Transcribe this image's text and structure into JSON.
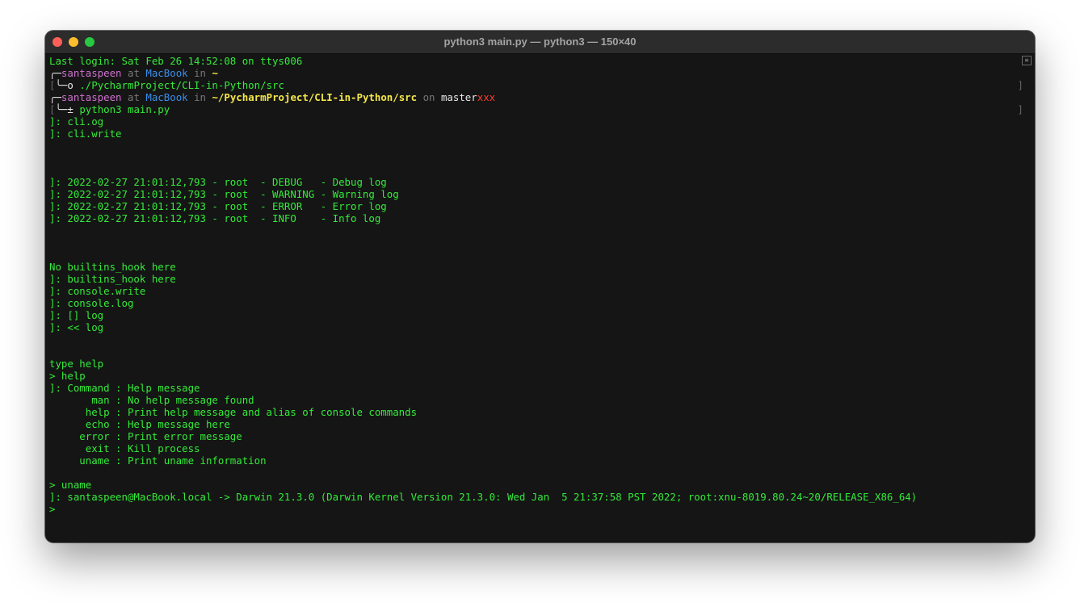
{
  "window": {
    "title": "python3 main.py — python3 — 150×40"
  },
  "prompt": {
    "user": "santaspeen",
    "at": "at",
    "host": "MacBook",
    "in": "in",
    "home": "~",
    "cmd1": "./PycharmProject/CLI-in-Python/src",
    "cwd": "~/PycharmProject/CLI-in-Python/src",
    "on": "on",
    "branch": "master",
    "dirty": "xxx",
    "cmd2": "python3 main.py"
  },
  "lines": {
    "login": "Last login: Sat Feb 26 14:52:08 on ttys006",
    "cli_og": "]: cli.og",
    "cli_write": "]: cli.write",
    "log_debug": "]: 2022-02-27 21:01:12,793 - root  - DEBUG   - Debug log",
    "log_warning": "]: 2022-02-27 21:01:12,793 - root  - WARNING - Warning log",
    "log_error": "]: 2022-02-27 21:01:12,793 - root  - ERROR   - Error log",
    "log_info": "]: 2022-02-27 21:01:12,793 - root  - INFO    - Info log",
    "no_hook": "No builtins_hook here",
    "hook": "]: builtins_hook here",
    "console_write": "]: console.write",
    "console_log": "]: console.log",
    "brackets_log": "]: [] log",
    "shift_log": "]: << log",
    "type_help": "type help",
    "cmd_help": "> help",
    "help_header": "]: Command : Help message",
    "help_man": "       man : No help message found",
    "help_help": "      help : Print help message and alias of console commands",
    "help_echo": "      echo : Help message here",
    "help_error": "     error : Print error message",
    "help_exit": "      exit : Kill process",
    "help_uname": "     uname : Print uname information",
    "cmd_uname": "> uname",
    "uname_out": "]: santaspeen@MacBook.local -> Darwin 21.3.0 (Darwin Kernel Version 21.3.0: Wed Jan  5 21:37:58 PST 2022; root:xnu-8019.80.24~20/RELEASE_X86_64)",
    "final_prompt": ">"
  }
}
